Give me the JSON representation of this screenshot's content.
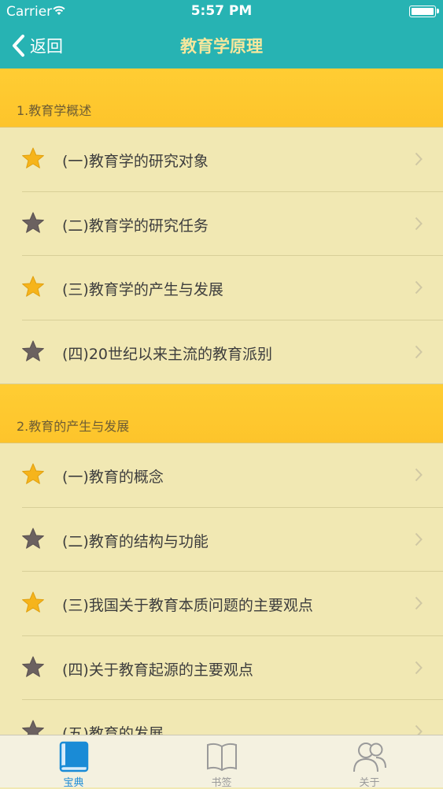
{
  "status_bar": {
    "carrier": "Carrier",
    "time": "5:57 PM"
  },
  "nav": {
    "back_label": "返回",
    "title": "教育学原理"
  },
  "sections": [
    {
      "title": "1.教育学概述",
      "items": [
        {
          "label": "(一)教育学的研究对象",
          "starred": true
        },
        {
          "label": "(二)教育学的研究任务",
          "starred": false
        },
        {
          "label": "(三)教育学的产生与发展",
          "starred": true
        },
        {
          "label": "(四)20世纪以来主流的教育派别",
          "starred": false
        }
      ]
    },
    {
      "title": "2.教育的产生与发展",
      "items": [
        {
          "label": "(一)教育的概念",
          "starred": true
        },
        {
          "label": "(二)教育的结构与功能",
          "starred": false
        },
        {
          "label": "(三)我国关于教育本质问题的主要观点",
          "starred": true
        },
        {
          "label": "(四)关于教育起源的主要观点",
          "starred": false
        },
        {
          "label": "(五)教育的发展",
          "starred": false
        }
      ]
    }
  ],
  "tabs": [
    {
      "label": "宝典",
      "icon": "book-icon",
      "active": true
    },
    {
      "label": "书签",
      "icon": "open-book-icon",
      "active": false
    },
    {
      "label": "关于",
      "icon": "people-icon",
      "active": false
    }
  ],
  "colors": {
    "header_bg": "#27b3b3",
    "section_header_bg": "#ffcd33",
    "list_bg": "#f1e8b3",
    "star_gold": "#f6b41b",
    "star_gray": "#6b6160",
    "tab_active": "#1a8bd6"
  }
}
